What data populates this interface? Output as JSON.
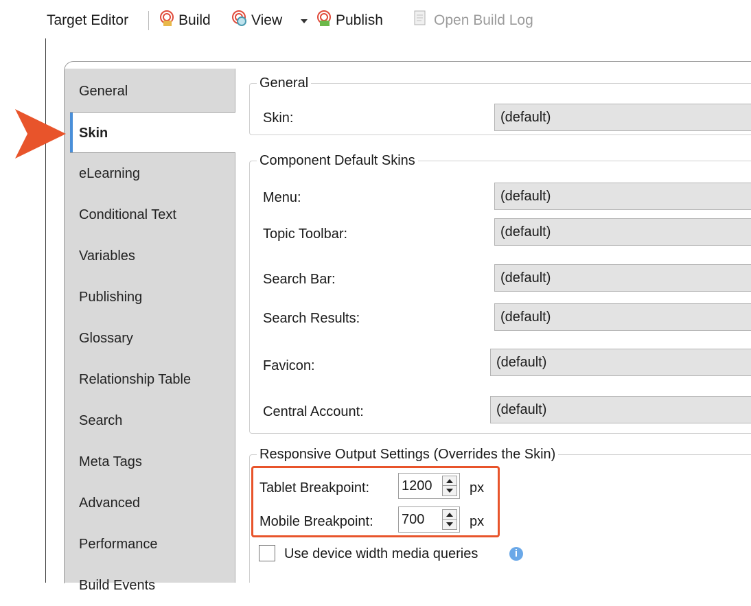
{
  "toolbar": {
    "title": "Target Editor",
    "build": "Build",
    "view": "View",
    "publish": "Publish",
    "open_build_log": "Open Build Log"
  },
  "tabs": [
    {
      "label": "General"
    },
    {
      "label": "Skin",
      "active": true
    },
    {
      "label": "eLearning"
    },
    {
      "label": "Conditional Text"
    },
    {
      "label": "Variables"
    },
    {
      "label": "Publishing"
    },
    {
      "label": "Glossary"
    },
    {
      "label": "Relationship Table"
    },
    {
      "label": "Search"
    },
    {
      "label": "Meta Tags"
    },
    {
      "label": "Advanced"
    },
    {
      "label": "Performance"
    },
    {
      "label": "Build Events"
    }
  ],
  "general_group": {
    "legend": "General",
    "skin_label": "Skin:",
    "skin_value": "(default)"
  },
  "component_group": {
    "legend": "Component Default Skins",
    "rows": [
      {
        "label": "Menu:",
        "value": "(default)"
      },
      {
        "label": "Topic Toolbar:",
        "value": "(default)"
      },
      {
        "label": "Search Bar:",
        "value": "(default)"
      },
      {
        "label": "Search Results:",
        "value": "(default)"
      },
      {
        "label": "Favicon:",
        "value": "(default)"
      },
      {
        "label": "Central Account:",
        "value": "(default)"
      }
    ]
  },
  "responsive_group": {
    "legend": "Responsive Output Settings (Overrides the Skin)",
    "tablet_label": "Tablet Breakpoint:",
    "tablet_value": "1200",
    "mobile_label": "Mobile Breakpoint:",
    "mobile_value": "700",
    "unit": "px",
    "device_width_label": "Use device width media queries",
    "device_width_checked": false
  },
  "colors": {
    "highlight": "#e8542b",
    "arrow": "#e8542b",
    "active_tab_accent": "#4a8fd9"
  }
}
